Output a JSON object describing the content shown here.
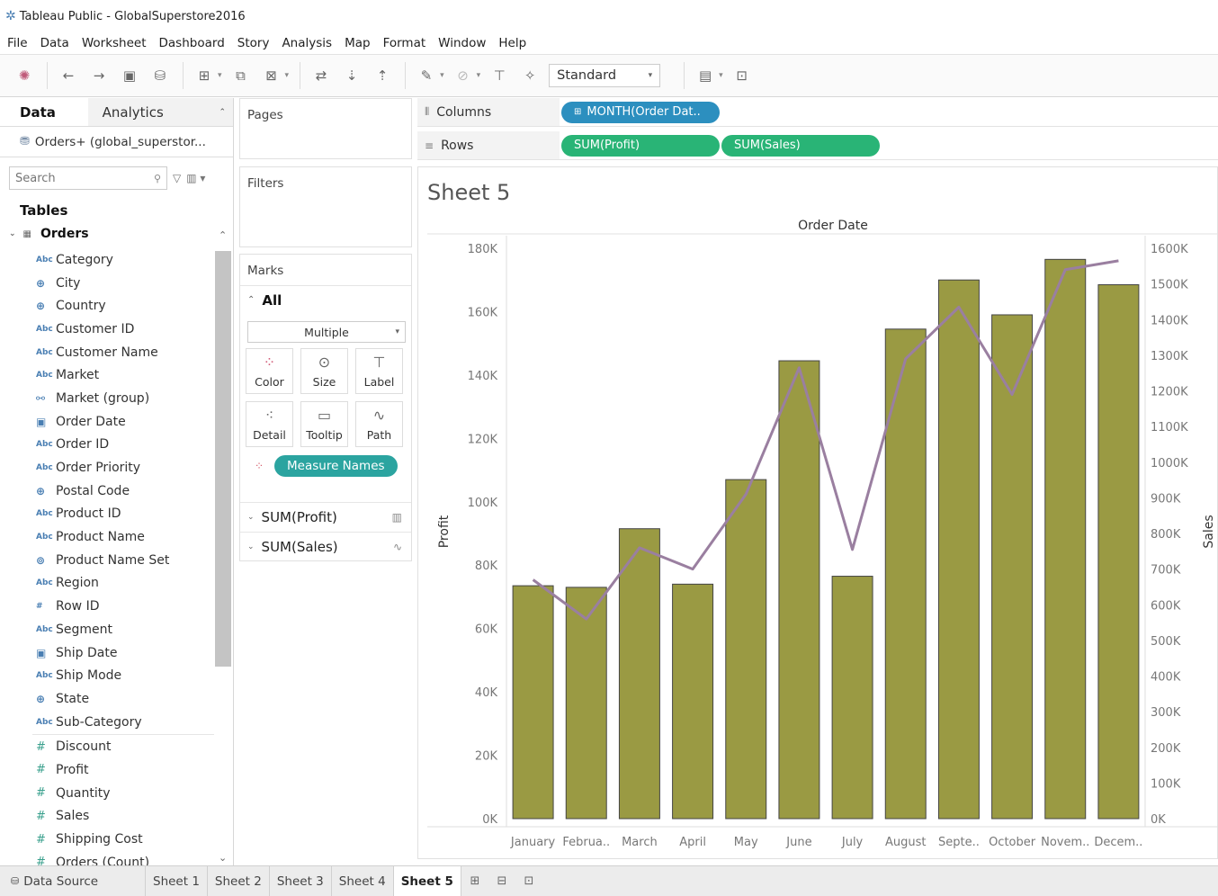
{
  "window": {
    "title": "Tableau Public - GlobalSuperstore2016"
  },
  "menu": [
    "File",
    "Data",
    "Worksheet",
    "Dashboard",
    "Story",
    "Analysis",
    "Map",
    "Format",
    "Window",
    "Help"
  ],
  "toolbar": {
    "fit_select": "Standard"
  },
  "datapane": {
    "tab_data": "Data",
    "tab_analytics": "Analytics",
    "source": "Orders+ (global_superstor...",
    "search_placeholder": "Search",
    "tables_title": "Tables",
    "table_name": "Orders",
    "fields": [
      {
        "label": "Category",
        "icon": "Abc"
      },
      {
        "label": "City",
        "icon": "globe"
      },
      {
        "label": "Country",
        "icon": "globe"
      },
      {
        "label": "Customer ID",
        "icon": "Abc"
      },
      {
        "label": "Customer Name",
        "icon": "Abc"
      },
      {
        "label": "Market",
        "icon": "Abc"
      },
      {
        "label": "Market (group)",
        "icon": "link"
      },
      {
        "label": "Order Date",
        "icon": "cal"
      },
      {
        "label": "Order ID",
        "icon": "Abc"
      },
      {
        "label": "Order Priority",
        "icon": "Abc"
      },
      {
        "label": "Postal Code",
        "icon": "globe"
      },
      {
        "label": "Product ID",
        "icon": "Abc"
      },
      {
        "label": "Product Name",
        "icon": "Abc"
      },
      {
        "label": "Product Name Set",
        "icon": "set"
      },
      {
        "label": "Region",
        "icon": "Abc"
      },
      {
        "label": "Row ID",
        "icon": "#"
      },
      {
        "label": "Segment",
        "icon": "Abc"
      },
      {
        "label": "Ship Date",
        "icon": "cal"
      },
      {
        "label": "Ship Mode",
        "icon": "Abc"
      },
      {
        "label": "State",
        "icon": "globe"
      },
      {
        "label": "Sub-Category",
        "icon": "Abc"
      }
    ],
    "measures": [
      {
        "label": "Discount",
        "icon": "#"
      },
      {
        "label": "Profit",
        "icon": "#"
      },
      {
        "label": "Quantity",
        "icon": "#"
      },
      {
        "label": "Sales",
        "icon": "#"
      },
      {
        "label": "Shipping Cost",
        "icon": "#"
      },
      {
        "label": "Orders (Count)",
        "icon": "#"
      }
    ]
  },
  "cards": {
    "pages": "Pages",
    "filters": "Filters",
    "marks": "Marks",
    "marks_all": "All",
    "mark_type": "Multiple",
    "mark_buttons": [
      "Color",
      "Size",
      "Label",
      "Detail",
      "Tooltip",
      "Path"
    ],
    "measure_names_pill": "Measure Names",
    "measure_rows": [
      "SUM(Profit)",
      "SUM(Sales)"
    ]
  },
  "shelves": {
    "columns_label": "Columns",
    "rows_label": "Rows",
    "columns_pill": "MONTH(Order Dat..",
    "rows_pills": [
      "SUM(Profit)",
      "SUM(Sales)"
    ]
  },
  "sheet": {
    "title": "Sheet 5"
  },
  "chart_data": {
    "type": "bar",
    "title": "Order Date",
    "categories": [
      "January",
      "Februa..",
      "March",
      "April",
      "May",
      "June",
      "July",
      "August",
      "Septe..",
      "October",
      "Novem..",
      "Decem.."
    ],
    "series": [
      {
        "name": "Profit",
        "type": "bar",
        "axis": "left",
        "values": [
          73500,
          73000,
          91500,
          74000,
          107000,
          144500,
          76500,
          154500,
          170000,
          159000,
          176500,
          168500
        ],
        "color": "#9a9a43"
      },
      {
        "name": "Sales",
        "type": "line",
        "axis": "right",
        "values": [
          670000,
          560000,
          760000,
          700000,
          910000,
          1265000,
          755000,
          1290000,
          1435000,
          1190000,
          1540000,
          1565000
        ],
        "color": "#9a7fa0"
      }
    ],
    "ylabel": "Profit",
    "y2label": "Sales",
    "ylim": [
      0,
      180000
    ],
    "y2lim": [
      0,
      1600000
    ],
    "yticks": [
      0,
      20000,
      40000,
      60000,
      80000,
      100000,
      120000,
      140000,
      160000,
      180000
    ],
    "yticklabels": [
      "0K",
      "20K",
      "40K",
      "60K",
      "80K",
      "100K",
      "120K",
      "140K",
      "160K",
      "180K"
    ],
    "y2ticks": [
      0,
      100000,
      200000,
      300000,
      400000,
      500000,
      600000,
      700000,
      800000,
      900000,
      1000000,
      1100000,
      1200000,
      1300000,
      1400000,
      1500000,
      1600000
    ],
    "y2ticklabels": [
      "0K",
      "100K",
      "200K",
      "300K",
      "400K",
      "500K",
      "600K",
      "700K",
      "800K",
      "900K",
      "1000K",
      "1100K",
      "1200K",
      "1300K",
      "1400K",
      "1500K",
      "1600K"
    ]
  },
  "statusbar": {
    "data_source": "Data Source",
    "sheets": [
      "Sheet 1",
      "Sheet 2",
      "Sheet 3",
      "Sheet 4",
      "Sheet 5"
    ],
    "active_sheet": "Sheet 5"
  }
}
